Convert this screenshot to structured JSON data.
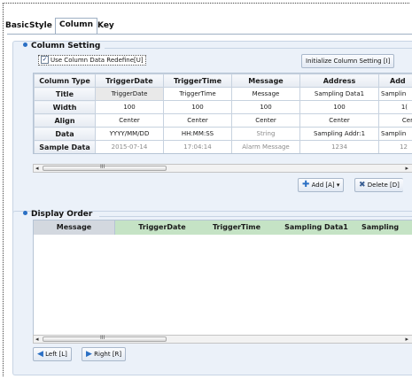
{
  "tabs": [
    "Basic",
    "Style",
    "Column",
    "Key"
  ],
  "active_tab": "Column",
  "column_setting": {
    "title": "Column Setting",
    "use_redefine_label": "Use Column Data Redefine[U]",
    "use_redefine_checked": true,
    "init_button": "Initialize Column Setting [I]",
    "headers": [
      "Column Type",
      "TriggerDate",
      "TriggerTime",
      "Message",
      "Address",
      "Add"
    ],
    "rows": [
      {
        "label": "Title",
        "cells": [
          "TriggerDate",
          "TriggerTime",
          "Message",
          "Sampling Data1",
          "Samplin"
        ]
      },
      {
        "label": "Width",
        "cells": [
          "100",
          "100",
          "100",
          "100",
          "1("
        ]
      },
      {
        "label": "Align",
        "cells": [
          "Center",
          "Center",
          "Center",
          "Center",
          "Cer"
        ]
      },
      {
        "label": "Data",
        "cells": [
          "YYYY/MM/DD",
          "HH:MM:SS",
          "String",
          "Sampling Addr:1",
          "Samplin"
        ]
      },
      {
        "label": "Sample Data",
        "cells": [
          "2015-07-14",
          "17:04:14",
          "Alarm Message",
          "1234",
          "12"
        ]
      }
    ],
    "add_button": "Add [A]",
    "delete_button": "Delete [D]"
  },
  "display_order": {
    "title": "Display Order",
    "headers": [
      "Message",
      "TriggerDate",
      "TriggerTime",
      "Sampling Data1",
      "Sampling"
    ],
    "left_button": "Left [L]",
    "right_button": "Right [R]"
  },
  "colors": {
    "panel_bg": "#ebf1f9",
    "green_header": "#c5e3c5",
    "gray_header": "#d3d8df",
    "accent": "#2a6fc4"
  }
}
